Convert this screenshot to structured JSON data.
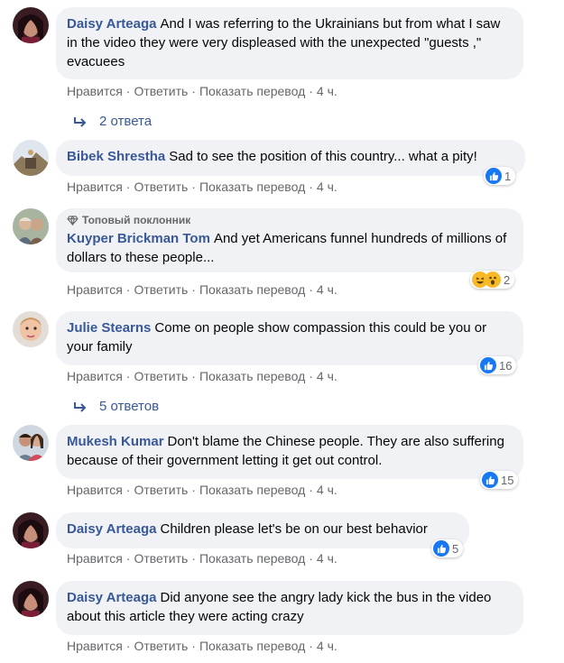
{
  "comments": [
    {
      "author": "Daisy Arteaga",
      "text": "And I was referring to the Ukrainians but from what I saw in the video they were very displeased with the unexpected \"guests ,\" evacuees",
      "actions": {
        "like": "Нравится",
        "reply": "Ответить",
        "translate": "Показать перевод",
        "time": "4 ч."
      },
      "replies_label": "2 ответа"
    },
    {
      "author": "Bibek Shrestha",
      "text": "Sad to see the position of this country... what a pity!",
      "actions": {
        "like": "Нравится",
        "reply": "Ответить",
        "translate": "Показать перевод",
        "time": "4 ч."
      },
      "reaction_count": "1"
    },
    {
      "badge": "Топовый поклонник",
      "author": "Kuyper Brickman Tom",
      "text": "And yet Americans funnel hundreds of millions of dollars to these people...",
      "actions": {
        "like": "Нравится",
        "reply": "Ответить",
        "translate": "Показать перевод",
        "time": "4 ч."
      },
      "reaction_count": "2"
    },
    {
      "author": "Julie Stearns",
      "text": "Come on people show compassion this could be you or your family",
      "actions": {
        "like": "Нравится",
        "reply": "Ответить",
        "translate": "Показать перевод",
        "time": "4 ч."
      },
      "reaction_count": "16",
      "replies_label": "5 ответов"
    },
    {
      "author": "Mukesh Kumar",
      "text": "Don't blame the Chinese people. They are also suffering because of their government letting it get out control.",
      "actions": {
        "like": "Нравится",
        "reply": "Ответить",
        "translate": "Показать перевод",
        "time": "4 ч."
      },
      "reaction_count": "15"
    },
    {
      "author": "Daisy Arteaga",
      "text": "Children please let's be on our best behavior",
      "actions": {
        "like": "Нравится",
        "reply": "Ответить",
        "translate": "Показать перевод",
        "time": "4 ч."
      },
      "reaction_count": "5"
    },
    {
      "author": "Daisy Arteaga",
      "text": "Did anyone see the angry lady kick the bus in the video about this article they were acting crazy",
      "actions": {
        "like": "Нравится",
        "reply": "Ответить",
        "translate": "Показать перевод",
        "time": "4 ч."
      }
    }
  ],
  "colors": {
    "author": "#385898",
    "bubble": "#f0f2f5",
    "meta": "#65676b",
    "like": "#1877f2"
  }
}
